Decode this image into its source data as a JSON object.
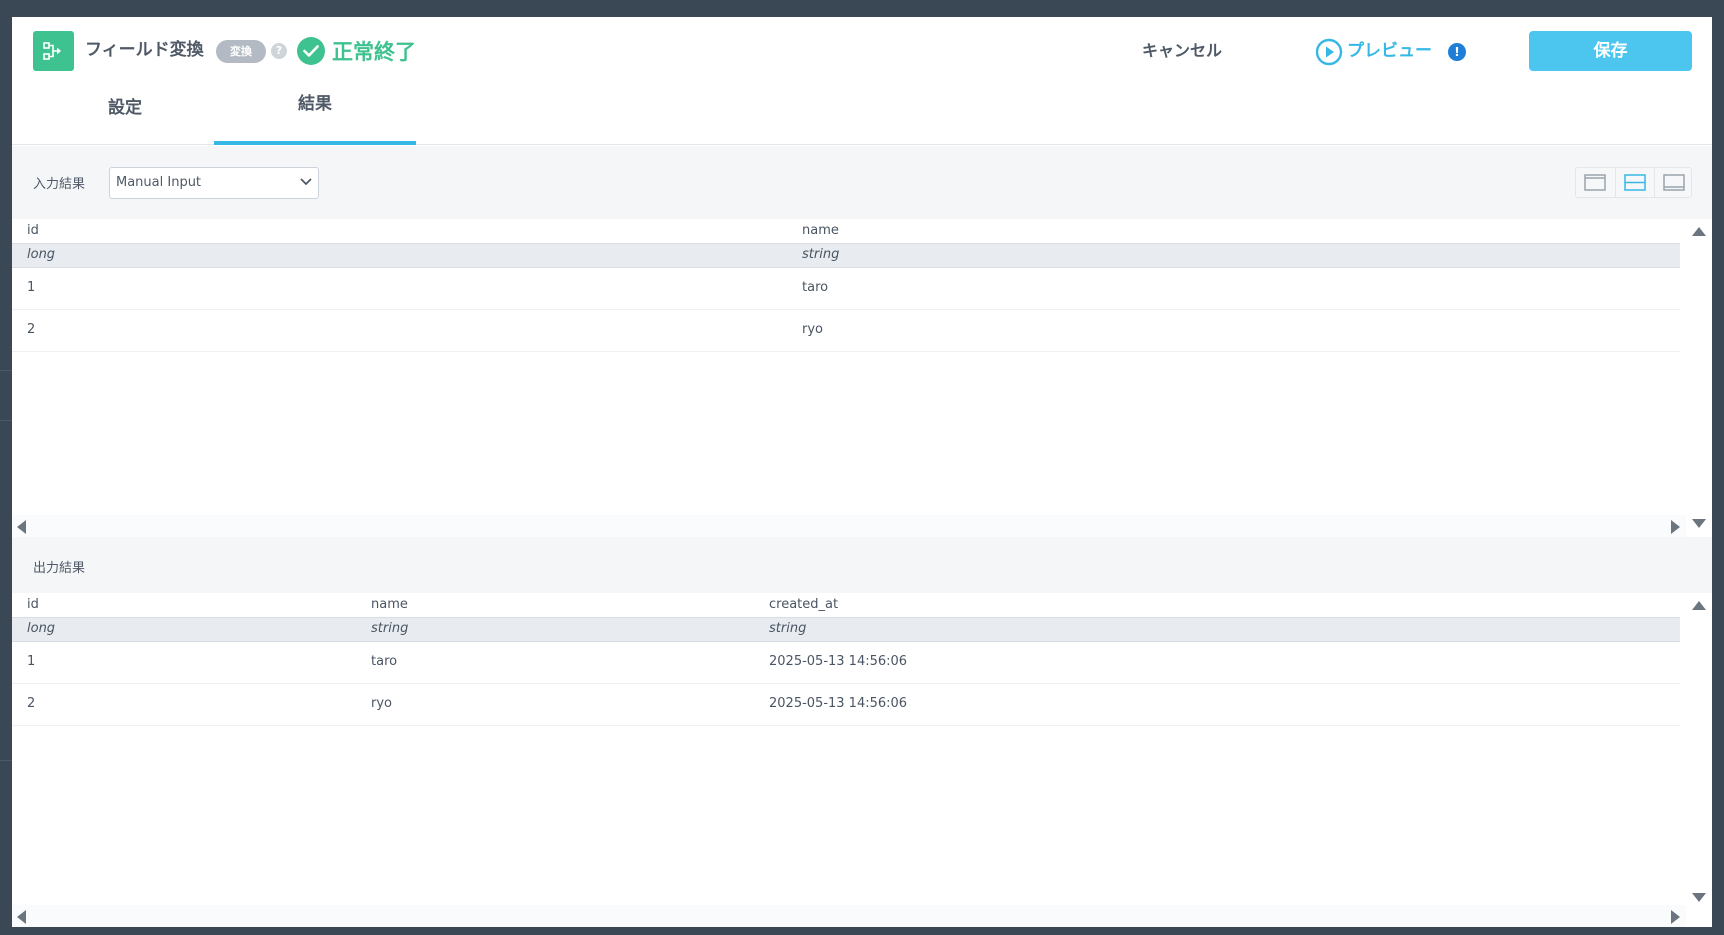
{
  "header": {
    "node_title": "フィールド変換",
    "node_type_badge": "変換",
    "help_glyph": "?",
    "status_text": "正常終了",
    "cancel_label": "キャンセル",
    "preview_label": "プレビュー",
    "preview_alert_glyph": "!",
    "save_label": "保存",
    "accent_color": "#4dc6ef",
    "success_color": "#3ec28f"
  },
  "tabs": [
    {
      "label": "設定",
      "active": false
    },
    {
      "label": "結果",
      "active": true
    }
  ],
  "input_panel": {
    "label": "入力結果",
    "select_value": "Manual Input",
    "columns": [
      "id",
      "name"
    ],
    "types": [
      "long",
      "string"
    ],
    "rows": [
      [
        "1",
        "taro"
      ],
      [
        "2",
        "ryo"
      ]
    ]
  },
  "output_panel": {
    "label": "出力結果",
    "columns": [
      "id",
      "name",
      "created_at"
    ],
    "types": [
      "long",
      "string",
      "string"
    ],
    "rows": [
      [
        "1",
        "taro",
        "2025-05-13 14:56:06"
      ],
      [
        "2",
        "ryo",
        "2025-05-13 14:56:06"
      ]
    ]
  }
}
